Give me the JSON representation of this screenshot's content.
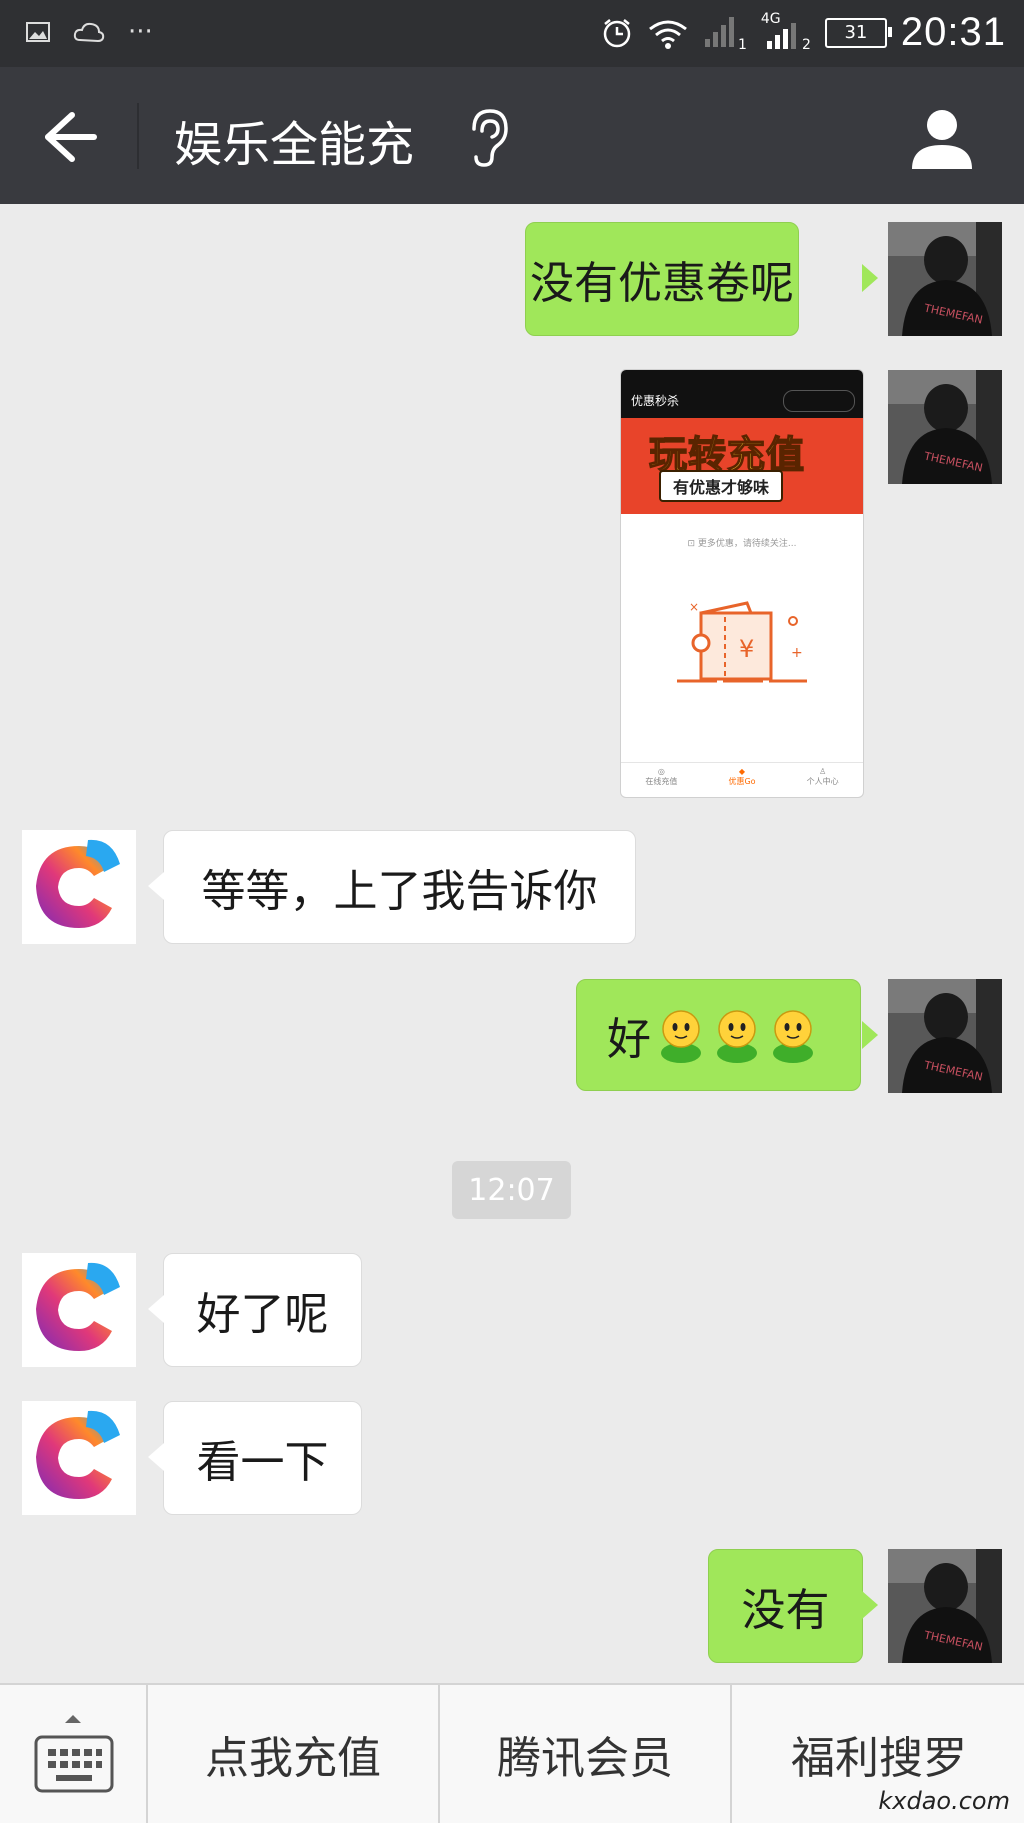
{
  "status_bar": {
    "time": "20:31",
    "network": "4G",
    "sim1": "1",
    "sim2": "2",
    "battery": "31",
    "notification_icons": [
      "gallery-icon",
      "weather-icon",
      "more-icon"
    ]
  },
  "header": {
    "title": "娱乐全能充"
  },
  "messages": [
    {
      "side": "me",
      "type": "text",
      "text": "没有优惠卷呢"
    },
    {
      "side": "me",
      "type": "image"
    },
    {
      "side": "other",
      "type": "text",
      "text": "等等，上了我告诉你"
    },
    {
      "side": "me",
      "type": "text",
      "text": "好",
      "emoji_count": 3
    },
    {
      "side": "other",
      "type": "text",
      "text": "好了呢"
    },
    {
      "side": "other",
      "type": "text",
      "text": "看一下"
    },
    {
      "side": "me",
      "type": "text",
      "text": "没有"
    }
  ],
  "timestamp": "12:07",
  "shared_image": {
    "page_title": "优惠秒杀",
    "banner_title": "玩转充值",
    "banner_subtitle": "有优惠才够味",
    "notice": "更多优惠，请待续关注...",
    "tabs": [
      "在线充值",
      "优惠Go",
      "个人中心"
    ],
    "active_tab_color": "#ff6a00"
  },
  "bottom_menu": {
    "items": [
      "点我充值",
      "腾讯会员",
      "福利搜罗"
    ]
  },
  "watermark": "kxdao.com",
  "colors": {
    "me_bubble": "#a0e75a",
    "other_bubble": "#ffffff",
    "title_bar": "#393a3f",
    "status_bar": "#2f3033"
  }
}
